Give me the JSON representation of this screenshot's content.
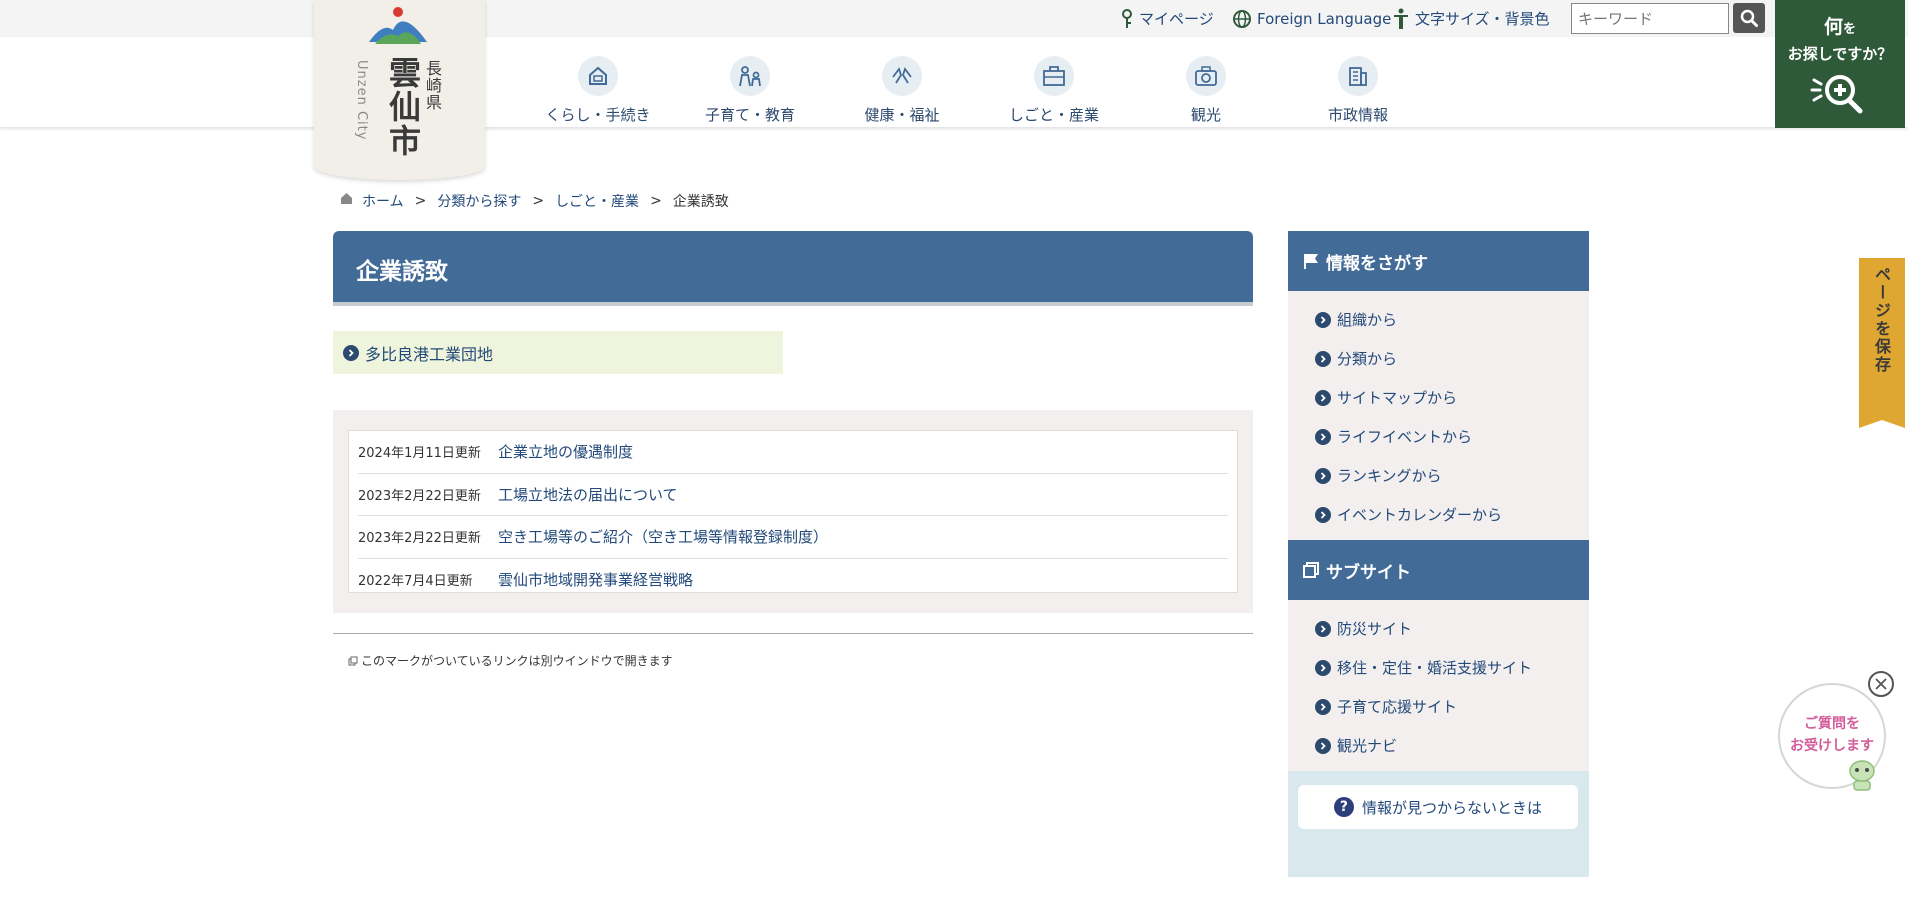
{
  "utility": {
    "mypage": "マイページ",
    "foreign": "Foreign Language",
    "textsize": "文字サイズ・背景色",
    "search_placeholder": "キーワード"
  },
  "logo": {
    "city": "雲仙市",
    "prefecture": "長崎県",
    "english": "Unzen City"
  },
  "search_box": {
    "line1": "何",
    "line1_small": "を",
    "line2": "お探しですか？"
  },
  "nav": [
    {
      "label": "くらし・手続き",
      "icon": "house-icon"
    },
    {
      "label": "子育て・教育",
      "icon": "family-icon"
    },
    {
      "label": "健康・福祉",
      "icon": "health-icon"
    },
    {
      "label": "しごと・産業",
      "icon": "briefcase-icon"
    },
    {
      "label": "観光",
      "icon": "camera-icon"
    },
    {
      "label": "市政情報",
      "icon": "building-icon"
    }
  ],
  "breadcrumb": {
    "home": "ホーム",
    "level1": "分類から探す",
    "level2": "しごと・産業",
    "current": "企業誘致",
    "separator": ">"
  },
  "page": {
    "title": "企業誘致",
    "category_link": "多比良港工業団地"
  },
  "updates": [
    {
      "date": "2024年1月11日更新",
      "title": "企業立地の優遇制度"
    },
    {
      "date": "2023年2月22日更新",
      "title": "工場立地法の届出について"
    },
    {
      "date": "2023年2月22日更新",
      "title": "空き工場等のご紹介（空き工場等情報登録制度）"
    },
    {
      "date": "2022年7月4日更新",
      "title": "雲仙市地域開発事業経営戦略"
    }
  ],
  "note": "このマークがついているリンクは別ウインドウで開きます",
  "sidebar": {
    "search_title": "情報をさがす",
    "search_items": [
      "組織から",
      "分類から",
      "サイトマップから",
      "ライフイベントから",
      "ランキングから",
      "イベントカレンダーから"
    ],
    "sub_title": "サブサイト",
    "sub_items": [
      "防災サイト",
      "移住・定住・婚活支援サイト",
      "子育て応援サイト",
      "観光ナビ"
    ],
    "notfound": "情報が見つからないときは"
  },
  "save_tab": "ページを保存",
  "chat": {
    "line1": "ご質問を",
    "line2": "お受けします"
  },
  "colors": {
    "primary": "#426b97",
    "accent_green": "#2f5a3a",
    "save_tab": "#e0a632",
    "link": "#234a7a"
  }
}
